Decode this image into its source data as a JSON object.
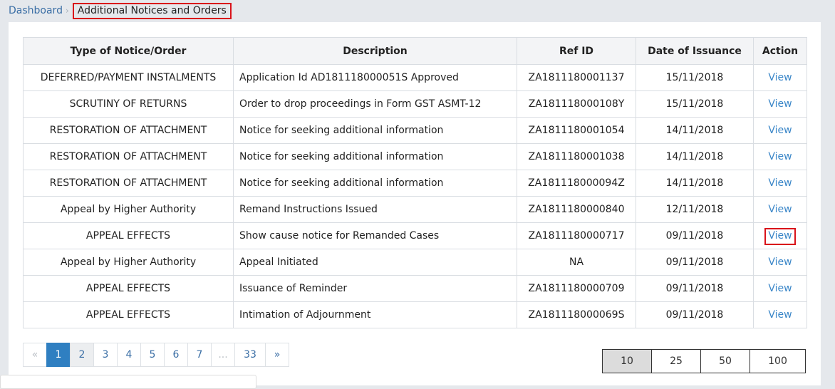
{
  "breadcrumb": {
    "home": "Dashboard",
    "separator": "›",
    "current": "Additional Notices and Orders"
  },
  "table": {
    "headers": [
      "Type of Notice/Order",
      "Description",
      "Ref ID",
      "Date of Issuance",
      "Action"
    ],
    "rows": [
      {
        "type": "DEFERRED/PAYMENT INSTALMENTS",
        "description": "Application Id AD181118000051S Approved",
        "ref": "ZA1811180001137",
        "date": "15/11/2018",
        "action": "View"
      },
      {
        "type": "SCRUTINY OF RETURNS",
        "description": "Order to drop proceedings in Form GST ASMT-12",
        "ref": "ZA181118000108Y",
        "date": "15/11/2018",
        "action": "View"
      },
      {
        "type": "RESTORATION OF ATTACHMENT",
        "description": "Notice for seeking additional information",
        "ref": "ZA1811180001054",
        "date": "14/11/2018",
        "action": "View"
      },
      {
        "type": "RESTORATION OF ATTACHMENT",
        "description": "Notice for seeking additional information",
        "ref": "ZA1811180001038",
        "date": "14/11/2018",
        "action": "View"
      },
      {
        "type": "RESTORATION OF ATTACHMENT",
        "description": "Notice for seeking additional information",
        "ref": "ZA181118000094Z",
        "date": "14/11/2018",
        "action": "View"
      },
      {
        "type": "Appeal by Higher Authority",
        "description": "Remand Instructions Issued",
        "ref": "ZA1811180000840",
        "date": "12/11/2018",
        "action": "View"
      },
      {
        "type": "APPEAL EFFECTS",
        "description": "Show cause notice for Remanded Cases",
        "ref": "ZA1811180000717",
        "date": "09/11/2018",
        "action": "View"
      },
      {
        "type": "Appeal by Higher Authority",
        "description": "Appeal Initiated",
        "ref": "NA",
        "date": "09/11/2018",
        "action": "View"
      },
      {
        "type": "APPEAL EFFECTS",
        "description": "Issuance of Reminder",
        "ref": "ZA1811180000709",
        "date": "09/11/2018",
        "action": "View"
      },
      {
        "type": "APPEAL EFFECTS",
        "description": "Intimation of Adjournment",
        "ref": "ZA181118000069S",
        "date": "09/11/2018",
        "action": "View"
      }
    ]
  },
  "pagination": {
    "prev": "«",
    "pages": [
      "1",
      "2",
      "3",
      "4",
      "5",
      "6",
      "7"
    ],
    "ellipsis": "...",
    "last": "33",
    "next": "»",
    "active": "1"
  },
  "page_size": {
    "options": [
      "10",
      "25",
      "50",
      "100"
    ],
    "selected": "10"
  },
  "colors": {
    "accent": "#2f7fc1",
    "link": "#3a86c8",
    "highlight": "#d9121a"
  }
}
